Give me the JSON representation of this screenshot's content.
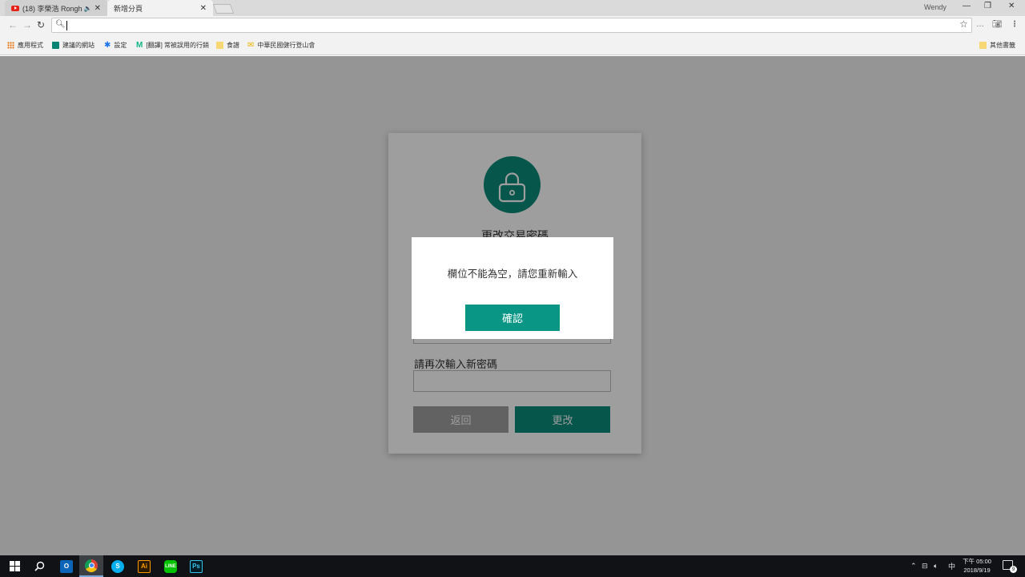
{
  "browser": {
    "tabs": [
      {
        "label": "(18) 李榮浩 Ronghao",
        "has_audio": true
      },
      {
        "label": "新增分頁",
        "active": true
      }
    ],
    "user_name": "Wendy",
    "address_value": "",
    "bookmarks": [
      {
        "label": "應用程式",
        "icon": "apps-icon"
      },
      {
        "label": "建議的網站",
        "icon": "bing-icon"
      },
      {
        "label": "設定",
        "icon": "gear-icon"
      },
      {
        "label": "[翻譯] 常被誤用的行銷",
        "icon": "medium-icon"
      },
      {
        "label": "食譜",
        "icon": "folder-icon"
      },
      {
        "label": "中華民國健行登山會",
        "icon": "site-icon"
      }
    ],
    "other_bookmarks": "其他書籤"
  },
  "form": {
    "title": "更改交易密碼",
    "confirm_label": "請再次輸入新密碼",
    "back_button": "返回",
    "submit_button": "更改",
    "accent_color": "#0b8b7a"
  },
  "dialog": {
    "message": "欄位不能為空，請您重新輸入",
    "ok_button": "確認"
  },
  "taskbar": {
    "apps": [
      "start",
      "search",
      "outlook",
      "chrome",
      "skype",
      "illustrator",
      "line",
      "photoshop"
    ],
    "ime": "中",
    "time": "下午 05:00",
    "date": "2018/9/19",
    "notification_count": "9"
  }
}
